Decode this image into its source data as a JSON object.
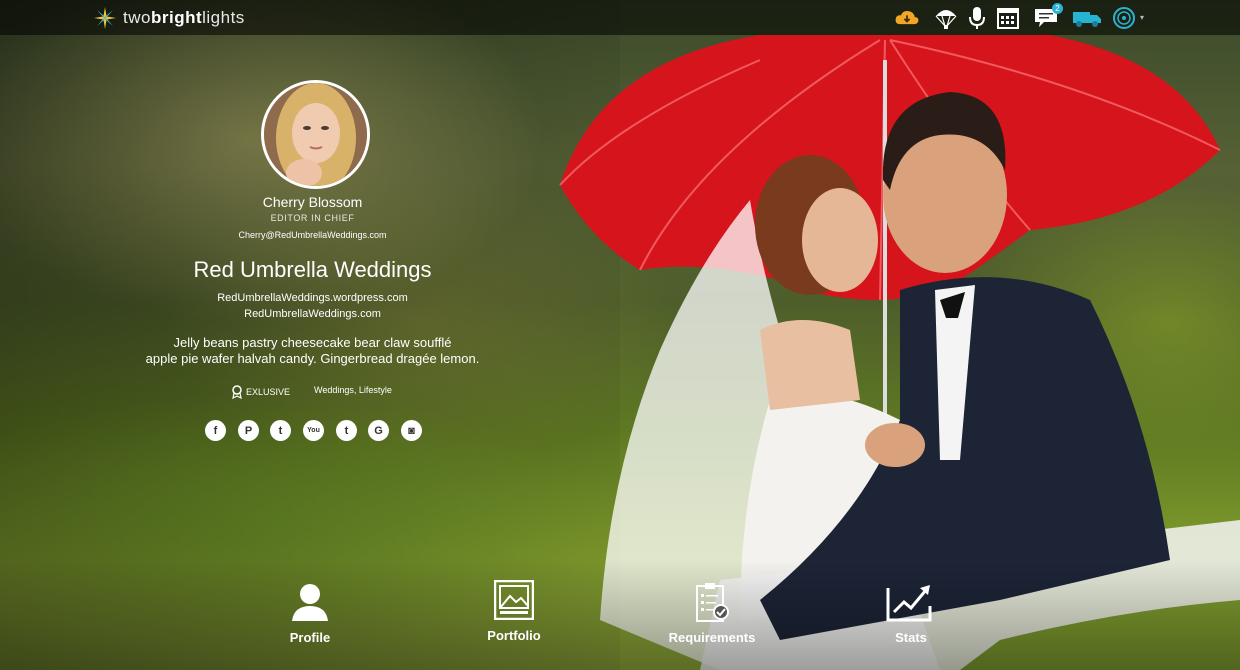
{
  "brand": {
    "logo_text_light": "two",
    "logo_text_bold": "bright",
    "logo_text_end": "lights",
    "logo_icon": "star-burst-icon"
  },
  "topbar": {
    "icons": [
      "cloud-download-icon",
      "parachute-icon",
      "microphone-icon",
      "calendar-icon",
      "chat-icon",
      "truck-icon",
      "avatar-dropdown-icon"
    ],
    "messages_badge": "2",
    "accent_orange": "#f2a623",
    "accent_teal": "#27b4d3"
  },
  "profile": {
    "name": "Cherry Blossom",
    "role": "EDITOR IN CHIEF",
    "email": "Cherry@RedUmbrellaWeddings.com",
    "blog_title": "Red Umbrella Weddings",
    "site_1": "RedUmbrellaWeddings.wordpress.com",
    "site_2": "RedUmbrellaWeddings.com",
    "description_line_1": "Jelly beans pastry cheesecake bear claw soufflé",
    "description_line_2": "apple pie wafer halvah candy. Gingerbread dragée lemon.",
    "exclusive_label": "EXLUSIVE",
    "categories": "Weddings, Lifestyle"
  },
  "social": [
    {
      "icon": "facebook-icon",
      "glyph": "f"
    },
    {
      "icon": "pinterest-icon",
      "glyph": "P"
    },
    {
      "icon": "twitter-icon",
      "glyph": "t"
    },
    {
      "icon": "youtube-icon",
      "glyph": "You"
    },
    {
      "icon": "tumblr-icon",
      "glyph": "t"
    },
    {
      "icon": "google-plus-icon",
      "glyph": "G"
    },
    {
      "icon": "instagram-icon",
      "glyph": "◙"
    }
  ],
  "nav": {
    "profile_label": "Profile",
    "portfolio_label": "Portfolio",
    "requirements_label": "Requirements",
    "stats_label": "Stats"
  }
}
